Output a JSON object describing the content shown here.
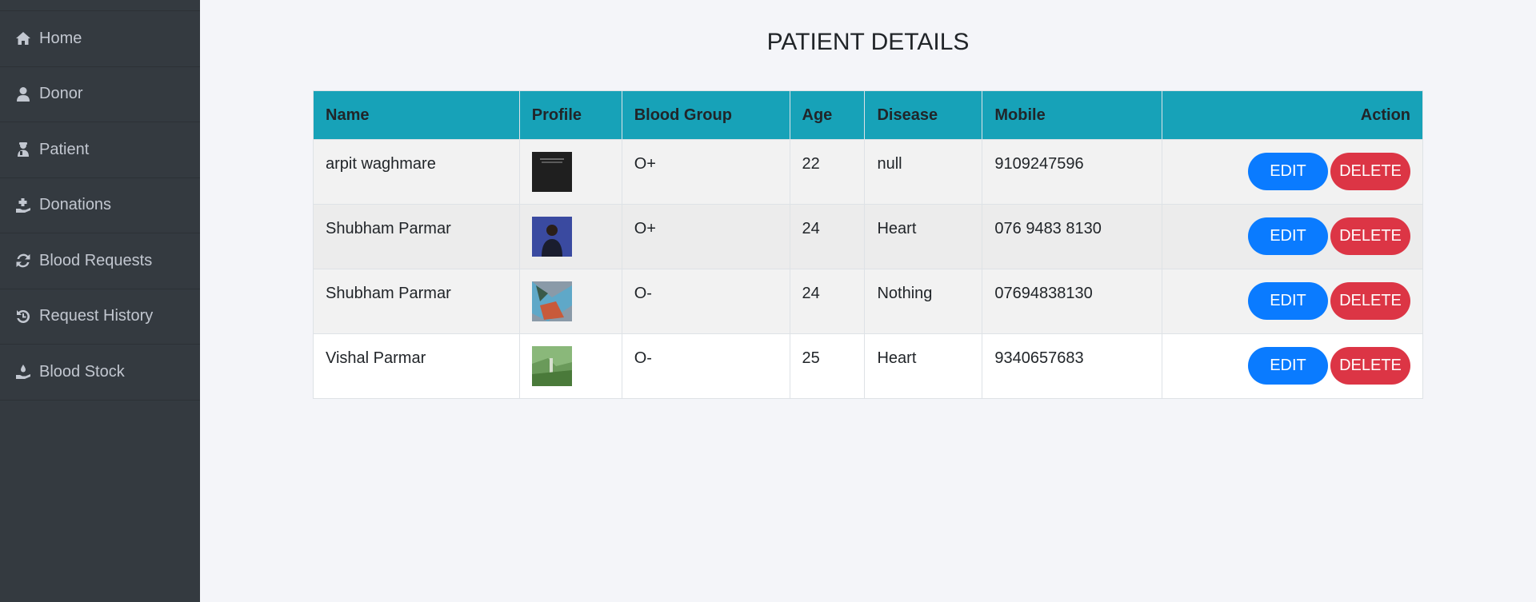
{
  "sidebar": {
    "items": [
      {
        "label": "Home",
        "icon": "home-icon"
      },
      {
        "label": "Donor",
        "icon": "user-icon"
      },
      {
        "label": "Patient",
        "icon": "patient-icon"
      },
      {
        "label": "Donations",
        "icon": "donation-icon"
      },
      {
        "label": "Blood Requests",
        "icon": "refresh-icon"
      },
      {
        "label": "Request History",
        "icon": "history-icon"
      },
      {
        "label": "Blood Stock",
        "icon": "hand-drop-icon"
      }
    ]
  },
  "page": {
    "title": "PATIENT DETAILS"
  },
  "table": {
    "headers": {
      "name": "Name",
      "profile": "Profile",
      "blood_group": "Blood Group",
      "age": "Age",
      "disease": "Disease",
      "mobile": "Mobile",
      "action": "Action"
    },
    "rows": [
      {
        "name": "arpit waghmare",
        "blood_group": "O+",
        "age": "22",
        "disease": "null",
        "mobile": "9109247596"
      },
      {
        "name": "Shubham Parmar",
        "blood_group": "O+",
        "age": "24",
        "disease": "Heart",
        "mobile": "076 9483 8130"
      },
      {
        "name": "Shubham Parmar",
        "blood_group": "O-",
        "age": "24",
        "disease": "Nothing",
        "mobile": "07694838130"
      },
      {
        "name": "Vishal Parmar",
        "blood_group": "O-",
        "age": "25",
        "disease": "Heart",
        "mobile": "9340657683"
      }
    ],
    "edit_label": "EDIT",
    "delete_label": "DELETE"
  },
  "colors": {
    "sidebar_bg": "#343a40",
    "header_bg": "#17a2b8",
    "edit_btn": "#0a7bff",
    "delete_btn": "#dc3545"
  }
}
